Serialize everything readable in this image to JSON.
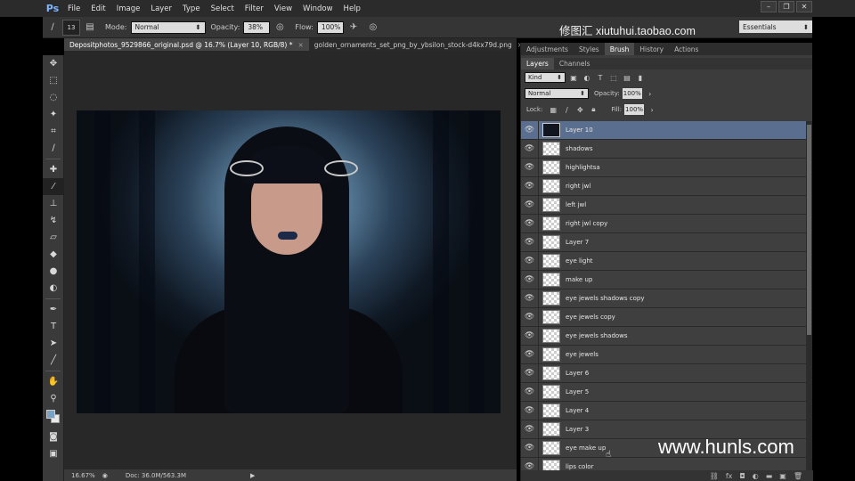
{
  "app": {
    "logo": "Ps"
  },
  "menu": [
    "File",
    "Edit",
    "Image",
    "Layer",
    "Type",
    "Select",
    "Filter",
    "View",
    "Window",
    "Help"
  ],
  "watermarks": {
    "top": "修图汇  xiutuhui.taobao.com",
    "bottom": "www.hunls.com"
  },
  "options_bar": {
    "brush_size": "13",
    "mode_label": "Mode:",
    "mode_value": "Normal",
    "opacity_label": "Opacity:",
    "opacity_value": "38%",
    "flow_label": "Flow:",
    "flow_value": "100%",
    "workspace": "Essentials"
  },
  "documents": [
    {
      "title": "Depositphotos_9529866_original.psd @ 16.7% (Layer 10, RGB/8) *",
      "active": true
    },
    {
      "title": "golden_ornaments_set_png_by_ybsilon_stock-d4kx79d.png",
      "active": false
    }
  ],
  "status": {
    "zoom": "16.67%",
    "doc": "Doc: 36.0M/563.3M"
  },
  "panel_tabs": [
    "Adjustments",
    "Styles",
    "Brush",
    "History",
    "Actions"
  ],
  "active_panel_tab": "Brush",
  "layer_tabs": [
    "Layers",
    "Channels"
  ],
  "layers_controls": {
    "filter": "Kind",
    "blend": "Normal",
    "opacity_label": "Opacity:",
    "opacity_value": "100%",
    "lock_label": "Lock:",
    "fill_label": "Fill:",
    "fill_value": "100%"
  },
  "layers": [
    {
      "name": "Layer 10",
      "selected": true,
      "thumb": "photo"
    },
    {
      "name": "shadows"
    },
    {
      "name": "highlightsa"
    },
    {
      "name": "right jwl"
    },
    {
      "name": "left jwl"
    },
    {
      "name": "right jwl copy"
    },
    {
      "name": "Layer 7"
    },
    {
      "name": "eye light"
    },
    {
      "name": "make up"
    },
    {
      "name": "eye jewels shadows copy"
    },
    {
      "name": "eye jewels copy"
    },
    {
      "name": "eye jewels shadows"
    },
    {
      "name": "eye jewels"
    },
    {
      "name": "Layer 6"
    },
    {
      "name": "Layer 5"
    },
    {
      "name": "Layer 4"
    },
    {
      "name": "Layer 3"
    },
    {
      "name": "eye make up"
    },
    {
      "name": "lips color"
    }
  ],
  "colors": {
    "foreground": "#7aa0c2",
    "background": "#e9e9e9",
    "selection": "#5a6f8f"
  }
}
